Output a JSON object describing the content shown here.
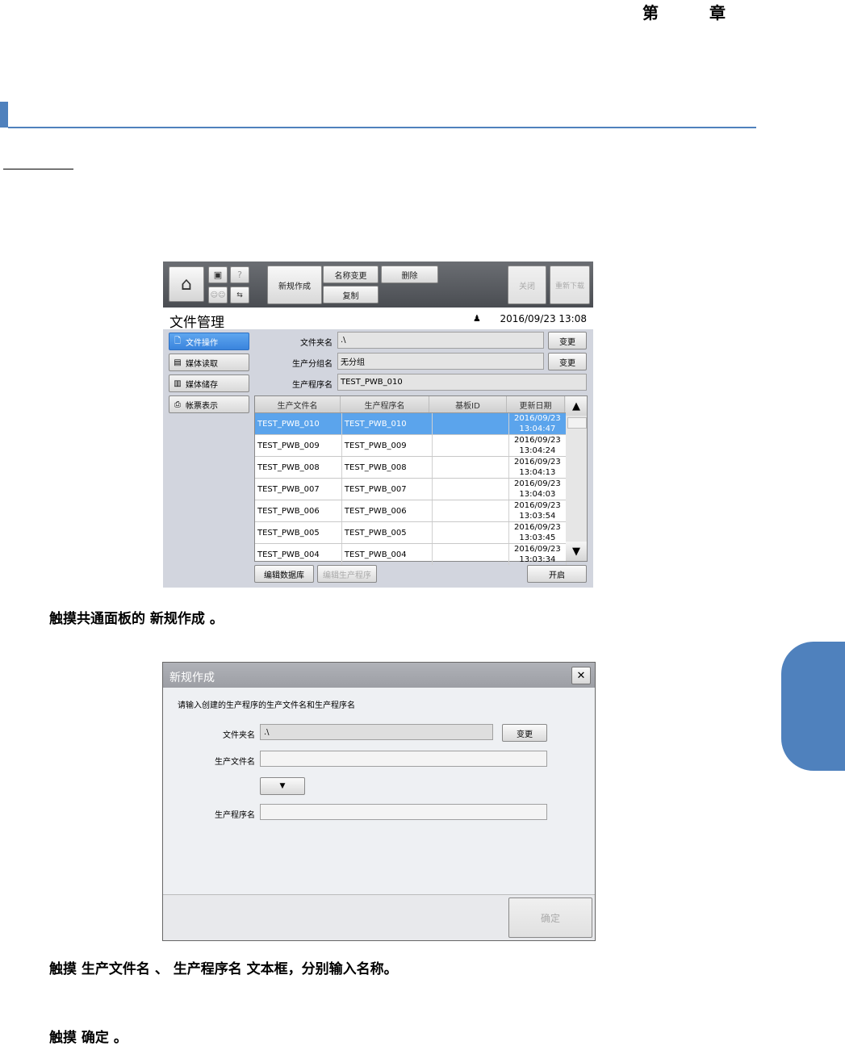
{
  "header": {
    "chapter_label": "第 章"
  },
  "screen1": {
    "toolbar": {
      "home_icon": "home-icon",
      "new_create": "新规作成",
      "rename": "名称变更",
      "delete": "删除",
      "copy": "复制",
      "close": "关闭",
      "redownload": "重新下载",
      "help_glyph": "?"
    },
    "title": "文件管理",
    "datetime": "2016/09/23 13:08",
    "sidebar": [
      {
        "label": "文件操作",
        "active": true,
        "icon": "file-operation-icon"
      },
      {
        "label": "媒体读取",
        "active": false,
        "icon": "media-read-icon"
      },
      {
        "label": "媒体储存",
        "active": false,
        "icon": "media-save-icon"
      },
      {
        "label": "帐票表示",
        "active": false,
        "icon": "printer-icon"
      }
    ],
    "fields": {
      "folder_label": "文件夹名",
      "folder_value": ".\\",
      "group_label": "生产分组名",
      "group_value": "无分组",
      "program_label": "生产程序名",
      "program_value": "TEST_PWB_010",
      "change": "变更"
    },
    "table": {
      "headers": [
        "生产文件名",
        "生产程序名",
        "基板ID",
        "更新日期"
      ],
      "rows": [
        {
          "file": "TEST_PWB_010",
          "program": "TEST_PWB_010",
          "board": "",
          "date": "2016/09/23",
          "time": "13:04:47",
          "selected": true
        },
        {
          "file": "TEST_PWB_009",
          "program": "TEST_PWB_009",
          "board": "",
          "date": "2016/09/23",
          "time": "13:04:24",
          "selected": false
        },
        {
          "file": "TEST_PWB_008",
          "program": "TEST_PWB_008",
          "board": "",
          "date": "2016/09/23",
          "time": "13:04:13",
          "selected": false
        },
        {
          "file": "TEST_PWB_007",
          "program": "TEST_PWB_007",
          "board": "",
          "date": "2016/09/23",
          "time": "13:04:03",
          "selected": false
        },
        {
          "file": "TEST_PWB_006",
          "program": "TEST_PWB_006",
          "board": "",
          "date": "2016/09/23",
          "time": "13:03:54",
          "selected": false
        },
        {
          "file": "TEST_PWB_005",
          "program": "TEST_PWB_005",
          "board": "",
          "date": "2016/09/23",
          "time": "13:03:45",
          "selected": false
        },
        {
          "file": "TEST_PWB_004",
          "program": "TEST_PWB_004",
          "board": "",
          "date": "2016/09/23",
          "time": "13:03:34",
          "selected": false
        }
      ]
    },
    "bottom": {
      "edit_db": "编辑数据库",
      "edit_program": "编辑生产程序",
      "open": "开启"
    }
  },
  "instruction1": "触摸共通面板的 新规作成 。",
  "screen2": {
    "title": "新规作成",
    "prompt": "请输入创建的生产程序的生产文件名和生产程序名",
    "folder_label": "文件夹名",
    "folder_value": ".\\",
    "change": "变更",
    "file_label": "生产文件名",
    "file_value": "",
    "dropdown_glyph": "▼",
    "program_label": "生产程序名",
    "program_value": "",
    "confirm": "确定"
  },
  "instruction2": "触摸 生产文件名 、 生产程序名 文本框，分别输入名称。",
  "instruction3": "触摸 确定 。",
  "colors": {
    "accent": "#4f81bd",
    "selection": "#5ba4ec"
  }
}
